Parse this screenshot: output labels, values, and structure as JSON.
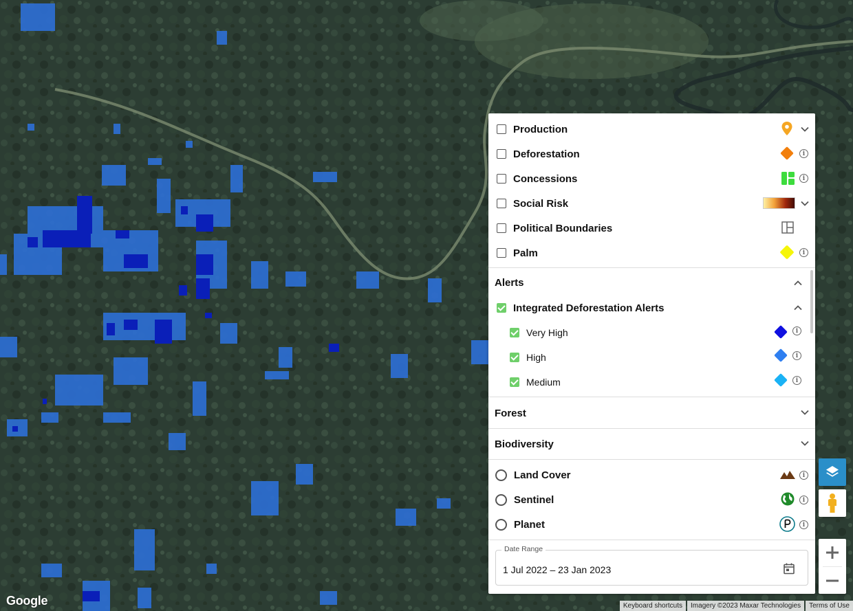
{
  "map": {
    "provider_logo": "Google",
    "attribution": {
      "keyboard_shortcuts": "Keyboard shortcuts",
      "imagery": "Imagery ©2023 Maxar Technologies",
      "terms": "Terms of Use"
    },
    "overlay_colors": {
      "very_high": "#0a1fb8",
      "high": "#2d6fd6",
      "forest_dark": "#26362d",
      "forest_mid": "#34473a"
    }
  },
  "layers": {
    "items": [
      {
        "label": "Production",
        "checked": false,
        "icon": "orange-pin-icon",
        "action": "chevron-down-icon",
        "color": "#f5a623"
      },
      {
        "label": "Deforestation",
        "checked": false,
        "icon": "orange-diamond-icon",
        "action": "info-icon",
        "color": "#f27f0c"
      },
      {
        "label": "Concessions",
        "checked": false,
        "icon": "green-blocks-icon",
        "action": "info-icon",
        "color": "#3ddc3d"
      },
      {
        "label": "Social Risk",
        "checked": false,
        "icon": "gradient-scale-icon",
        "action": "chevron-down-icon",
        "color": "#7a1208"
      },
      {
        "label": "Political Boundaries",
        "checked": false,
        "icon": "boundary-layout-icon",
        "action": "",
        "color": "#666666"
      },
      {
        "label": "Palm",
        "checked": false,
        "icon": "yellow-diamond-icon",
        "action": "info-icon",
        "color": "#f5f50a"
      }
    ]
  },
  "alerts": {
    "title": "Alerts",
    "group_label": "Integrated Deforestation Alerts",
    "group_checked": true,
    "levels": [
      {
        "label": "Very High",
        "checked": true,
        "color": "#1010e0"
      },
      {
        "label": "High",
        "checked": true,
        "color": "#2f7ff0"
      },
      {
        "label": "Medium",
        "checked": true,
        "color": "#1ab2f5"
      }
    ]
  },
  "sections": {
    "forest": "Forest",
    "biodiversity": "Biodiversity"
  },
  "basemaps": [
    {
      "label": "Land Cover",
      "icon": "mountains-icon",
      "color": "#6b3a14"
    },
    {
      "label": "Sentinel",
      "icon": "globe-icon",
      "color": "#1f8a2a"
    },
    {
      "label": "Planet",
      "icon": "planet-p-icon",
      "color": "#0b7a8a"
    }
  ],
  "date_range": {
    "legend": "Date Range",
    "value": "1 Jul 2022 – 23 Jan 2023"
  },
  "controls": {
    "layers_button_color": "#2a8fc9"
  }
}
